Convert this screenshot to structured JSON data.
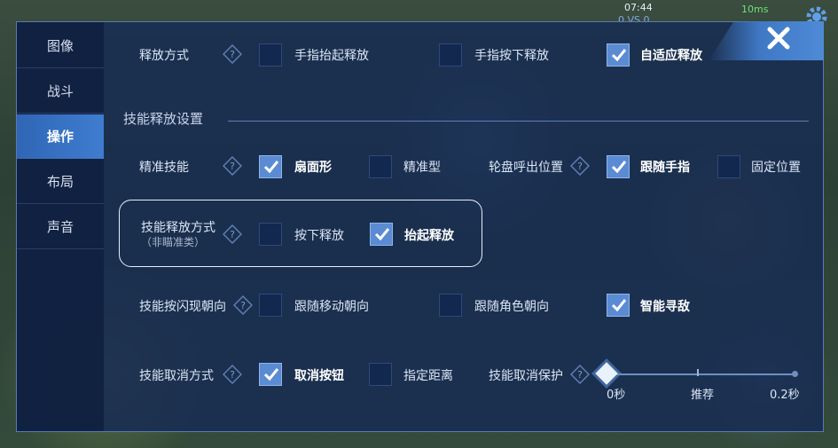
{
  "hud": {
    "time": "07:44",
    "score": "0 VS 0",
    "ping": "10ms"
  },
  "sidebar": {
    "items": [
      {
        "label": "图像",
        "active": false
      },
      {
        "label": "战斗",
        "active": false
      },
      {
        "label": "操作",
        "active": true
      },
      {
        "label": "布局",
        "active": false
      },
      {
        "label": "声音",
        "active": false
      }
    ]
  },
  "row1": {
    "label": "释放方式",
    "options": [
      "手指抬起释放",
      "手指按下释放",
      "自适应释放"
    ],
    "selected": "自适应释放"
  },
  "section": {
    "title": "技能释放设置"
  },
  "row2": {
    "label": "精准技能",
    "options": [
      "扇面形",
      "精准型"
    ],
    "selected": "扇面形",
    "wheel_label": "轮盘呼出位置",
    "wheel_options": [
      "跟随手指",
      "固定位置"
    ],
    "wheel_selected": "跟随手指"
  },
  "row3": {
    "label": "技能释放方式",
    "sublabel": "（非瞄准类）",
    "options": [
      "按下释放",
      "抬起释放"
    ],
    "selected": "抬起释放"
  },
  "row4": {
    "label": "技能按闪现朝向",
    "options": [
      "跟随移动朝向",
      "跟随角色朝向",
      "智能寻敌"
    ],
    "selected": "智能寻敌"
  },
  "row5": {
    "label": "技能取消方式",
    "options": [
      "取消按钮",
      "指定距离"
    ],
    "selected": "取消按钮",
    "protect_label": "技能取消保护",
    "slider": {
      "min_label": "0秒",
      "mid_label": "推荐",
      "max_label": "0.2秒",
      "value": 0
    }
  },
  "colors": {
    "panel": "#182c52",
    "active_tab": "#3f7dd0",
    "checkbox_on": "#5a8bd3"
  }
}
